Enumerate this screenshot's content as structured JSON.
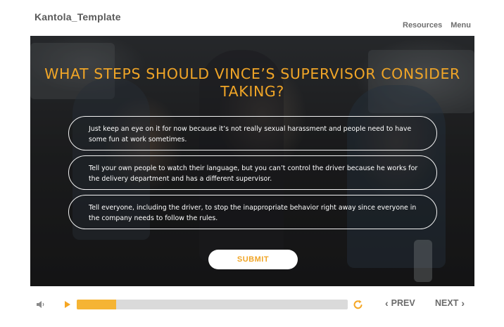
{
  "app": {
    "course_title": "Kantola_Template"
  },
  "header": {
    "links": [
      {
        "label": "Resources"
      },
      {
        "label": "Menu"
      }
    ]
  },
  "slide": {
    "question": "WHAT STEPS SHOULD VINCE’S SUPERVISOR CONSIDER TAKING?",
    "options": [
      {
        "text": "Just keep an eye on it for now because it’s not really sexual harassment and people need to have some fun at work sometimes."
      },
      {
        "text": "Tell your own people to watch their language, but you can’t control the driver because he works for the delivery department and has a different supervisor."
      },
      {
        "text": "Tell everyone, including the driver, to stop the inappropriate behavior right away since everyone in the company needs to follow the rules."
      }
    ],
    "submit_label": "SUBMIT"
  },
  "player": {
    "progress": 0.145,
    "prev_label": "PREV",
    "next_label": "NEXT",
    "icons": {
      "volume": "speaker-icon",
      "play": "play-icon",
      "replay": "replay-icon"
    }
  },
  "colors": {
    "accent": "#f0a527",
    "progress_fill": "#f5b434",
    "progress_track": "#dadada",
    "muted_text": "#6b6b6b"
  }
}
